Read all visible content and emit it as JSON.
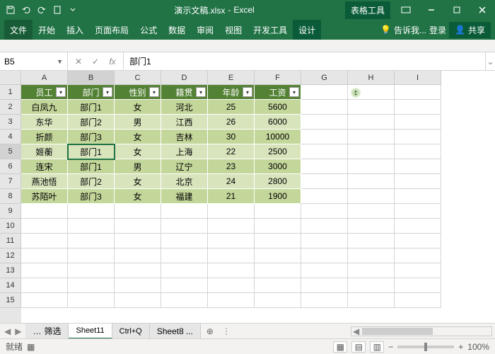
{
  "titlebar": {
    "document": "演示文稿.xlsx",
    "app": "Excel",
    "context_tab": "表格工具"
  },
  "tabs": {
    "file": "文件",
    "home": "开始",
    "insert": "插入",
    "layout": "页面布局",
    "formulas": "公式",
    "data": "数据",
    "review": "审阅",
    "view": "视图",
    "dev": "开发工具",
    "design": "设计"
  },
  "ribbon_right": {
    "tell_me": "告诉我...",
    "signin": "登录",
    "share": "共享"
  },
  "namebox": {
    "ref": "B5",
    "fx": "fx"
  },
  "formula_bar": {
    "value": "部门1"
  },
  "columns": [
    "A",
    "B",
    "C",
    "D",
    "E",
    "F",
    "G",
    "H",
    "I"
  ],
  "row_count": 15,
  "selected_row": 5,
  "selected_col": "B",
  "headers": [
    "员工",
    "部门",
    "性别",
    "籍贯",
    "年龄",
    "工资"
  ],
  "rows": [
    [
      "白凤九",
      "部门1",
      "女",
      "河北",
      "25",
      "5600"
    ],
    [
      "东华",
      "部门2",
      "男",
      "江西",
      "26",
      "6000"
    ],
    [
      "折颜",
      "部门3",
      "女",
      "吉林",
      "30",
      "10000"
    ],
    [
      "姬蘅",
      "部门1",
      "女",
      "上海",
      "22",
      "2500"
    ],
    [
      "连宋",
      "部门1",
      "男",
      "辽宁",
      "23",
      "3000"
    ],
    [
      "燕池悟",
      "部门2",
      "女",
      "北京",
      "24",
      "2800"
    ],
    [
      "苏陌叶",
      "部门3",
      "女",
      "福建",
      "21",
      "1900"
    ]
  ],
  "sheets": {
    "s1": "筛选",
    "s2": "Sheet11",
    "s3": "Ctrl+Q",
    "s4": "Sheet8",
    "more": "...",
    "add": "⊕",
    "nav": "⋮"
  },
  "status": {
    "ready": "就绪",
    "zoom": "100%",
    "minus": "−",
    "plus": "+"
  },
  "cursor_col": "G",
  "chart_data": {
    "type": "table",
    "title": "",
    "columns": [
      "员工",
      "部门",
      "性别",
      "籍贯",
      "年龄",
      "工资"
    ],
    "rows": [
      [
        "白凤九",
        "部门1",
        "女",
        "河北",
        25,
        5600
      ],
      [
        "东华",
        "部门2",
        "男",
        "江西",
        26,
        6000
      ],
      [
        "折颜",
        "部门3",
        "女",
        "吉林",
        30,
        10000
      ],
      [
        "姬蘅",
        "部门1",
        "女",
        "上海",
        22,
        2500
      ],
      [
        "连宋",
        "部门1",
        "男",
        "辽宁",
        23,
        3000
      ],
      [
        "燕池悟",
        "部门2",
        "女",
        "北京",
        24,
        2800
      ],
      [
        "苏陌叶",
        "部门3",
        "女",
        "福建",
        21,
        1900
      ]
    ]
  }
}
